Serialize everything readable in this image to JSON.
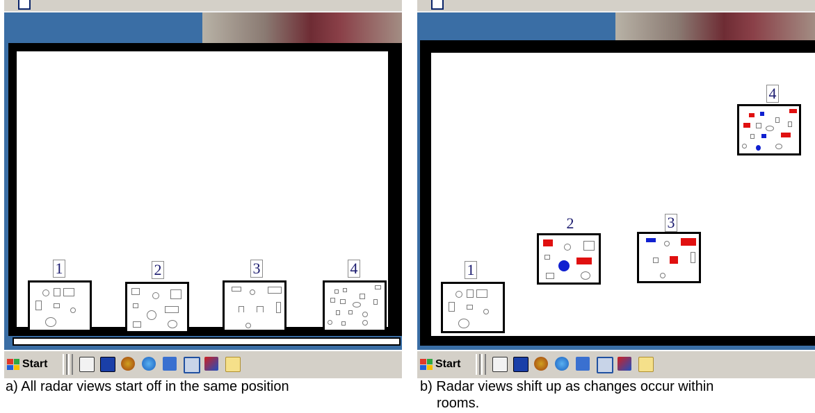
{
  "taskbar": {
    "start_label": "Start"
  },
  "panels": [
    {
      "id": "a",
      "caption": "a) All radar views start off in the same position",
      "radars": [
        {
          "label": "1"
        },
        {
          "label": "2"
        },
        {
          "label": "3"
        },
        {
          "label": "4"
        }
      ]
    },
    {
      "id": "b",
      "caption_line1": "b) Radar views shift up as changes occur within",
      "caption_line2": "rooms.",
      "radars": [
        {
          "label": "1"
        },
        {
          "label": "2"
        },
        {
          "label": "3"
        },
        {
          "label": "4"
        }
      ]
    }
  ],
  "colors": {
    "desktop": "#3a6ea5",
    "taskbar": "#d4d0c8",
    "change_red": "#e01010",
    "change_blue": "#1020d0",
    "label_text": "#1a1a6e"
  },
  "icons": [
    "start-logo-icon",
    "edit-icon",
    "word-icon",
    "globe-icon",
    "ie-icon",
    "network-icon",
    "monitor-icon",
    "notepad-icon",
    "folder-icon"
  ]
}
